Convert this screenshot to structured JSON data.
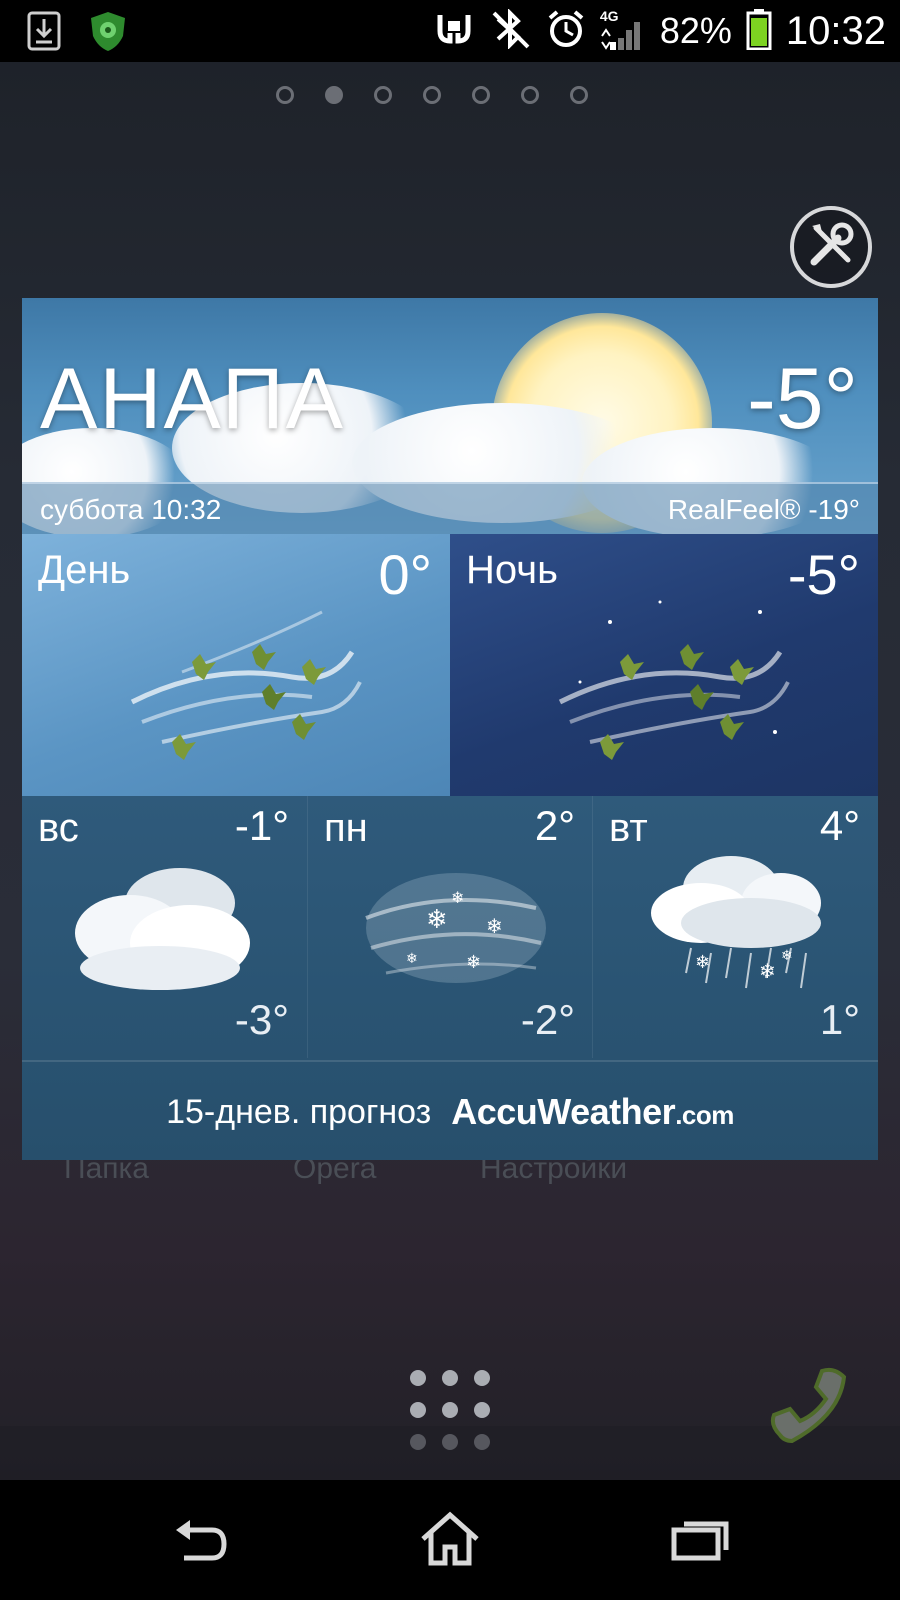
{
  "status_bar": {
    "battery_percent": "82%",
    "network": "4G",
    "time": "10:32",
    "icons": [
      "download-notification-icon",
      "antivirus-shield-icon",
      "nfc-icon",
      "bluetooth-off-icon",
      "alarm-icon",
      "signal-icon",
      "battery-icon"
    ]
  },
  "home": {
    "page_count": 7,
    "active_page": 2,
    "background_labels": [
      "Папка",
      "Opera",
      "Настройки"
    ]
  },
  "weather_widget": {
    "city": "АНАПА",
    "current_temp": "-5°",
    "date_time": "суббота 10:32",
    "realfeel": "RealFeel® -19°",
    "day": {
      "label": "День",
      "temp": "0°"
    },
    "night": {
      "label": "Ночь",
      "temp": "-5°"
    },
    "forecast": [
      {
        "day": "вс",
        "high": "-1°",
        "low": "-3°",
        "icon": "cloudy-icon"
      },
      {
        "day": "пн",
        "high": "2°",
        "low": "-2°",
        "icon": "snow-wind-icon"
      },
      {
        "day": "вт",
        "high": "4°",
        "low": "1°",
        "icon": "rain-snow-icon"
      }
    ],
    "footer": {
      "link": "15-днев. прогноз",
      "brand": "AccuWeather",
      "brand_suffix": ".com"
    }
  }
}
